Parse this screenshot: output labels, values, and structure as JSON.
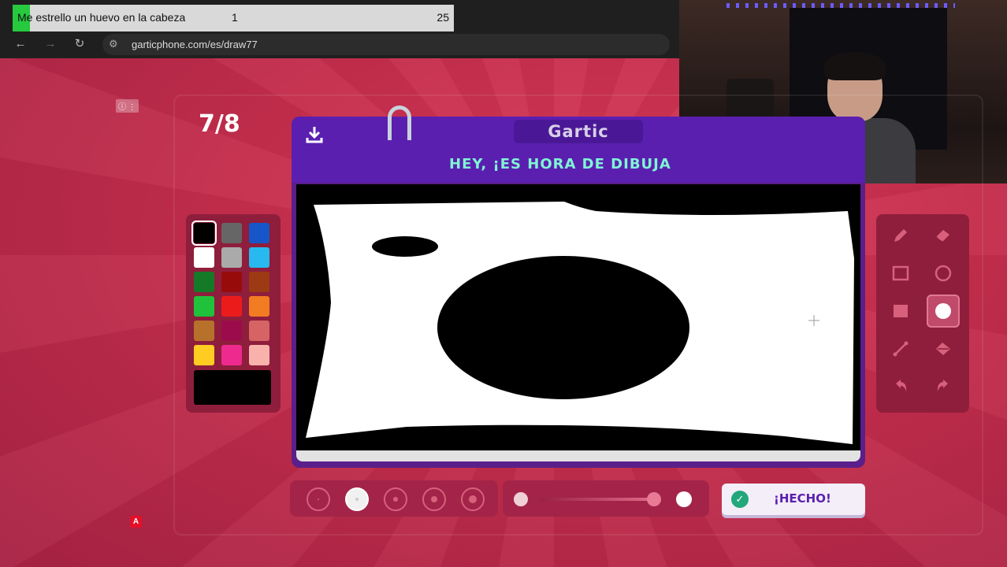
{
  "browser": {
    "progress": {
      "title": "Me estrello un huevo en la cabeza",
      "count": "1",
      "total": "25",
      "fill_fraction": 0.04
    },
    "url": "garticphone.com/es/draw77",
    "icons": [
      "back-arrow-icon",
      "forward-arrow-icon",
      "reload-icon",
      "site-settings-icon"
    ]
  },
  "game": {
    "turn": "7/8",
    "brand": "Gartic",
    "instruction": "HEY, ¡ES HORA DE DIBUJA",
    "tiny_badge": "A",
    "done_label": "¡HECHO!"
  },
  "palette": {
    "colors": [
      "#000000",
      "#666666",
      "#1756c8",
      "#ffffff",
      "#aaaaaa",
      "#27b9ef",
      "#157a28",
      "#980b0b",
      "#9b3a13",
      "#1fc23a",
      "#ec1b1b",
      "#f27c22",
      "#b7712a",
      "#9c0c4c",
      "#d76464",
      "#ffcc22",
      "#ee2a8e",
      "#f9b2ab"
    ],
    "selected": "#000000",
    "current": "#000000"
  },
  "tools": [
    {
      "name": "pencil-icon",
      "selected": false
    },
    {
      "name": "eraser-icon",
      "selected": false
    },
    {
      "name": "rectangle-outline-icon",
      "selected": false
    },
    {
      "name": "ellipse-outline-icon",
      "selected": false
    },
    {
      "name": "rectangle-filled-icon",
      "selected": false
    },
    {
      "name": "ellipse-filled-icon",
      "selected": true
    },
    {
      "name": "line-icon",
      "selected": false
    },
    {
      "name": "fill-bucket-icon",
      "selected": false
    },
    {
      "name": "undo-icon",
      "selected": false
    },
    {
      "name": "redo-icon",
      "selected": false
    }
  ],
  "brush_sizes": {
    "count": 5,
    "selected_index": 1
  },
  "opacity": {
    "level": 0.9
  }
}
